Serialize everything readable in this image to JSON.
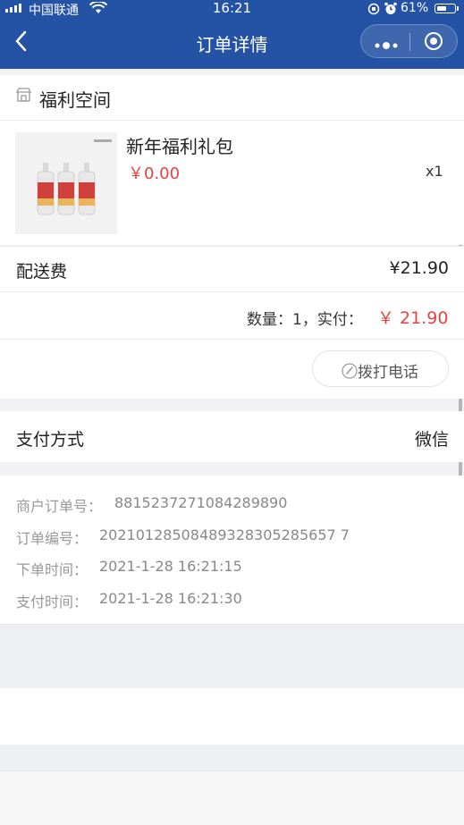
{
  "status_bar": {
    "carrier": "中国联通",
    "time": "16:21",
    "battery": "61%",
    "battery_level": 0.61
  },
  "nav": {
    "title": "订单详情",
    "back_icon": "chevron-left-icon",
    "more_icon": "more-dots-icon",
    "close_icon": "target-circle-icon"
  },
  "store": {
    "name": "福利空间",
    "icon": "store-icon"
  },
  "product": {
    "name": "新年福利礼包",
    "price": "￥0.00",
    "quantity": "x1",
    "image_label": "小酒酒"
  },
  "shipping": {
    "label": "配送费",
    "value": "¥21.90"
  },
  "summary": {
    "qty_label": "数量：1，实付：",
    "amount": "￥ 21.90"
  },
  "call_button": {
    "label": "拨打电话",
    "icon": "phone-icon"
  },
  "payment": {
    "label": "支付方式",
    "value": "微信"
  },
  "order_info": [
    {
      "label": "商户订单号：",
      "value": "8815237271084289890"
    },
    {
      "label": "订单编号：",
      "value": "20210128508489328305285657 7"
    },
    {
      "label": "下单时间：",
      "value": "2021-1-28 16:21:15"
    },
    {
      "label": "支付时间：",
      "value": "2021-1-28 16:21:30"
    }
  ],
  "colors": {
    "nav_bg": "#2453a5",
    "price_red": "#e64340",
    "page_bg": "#f2f2f4"
  }
}
